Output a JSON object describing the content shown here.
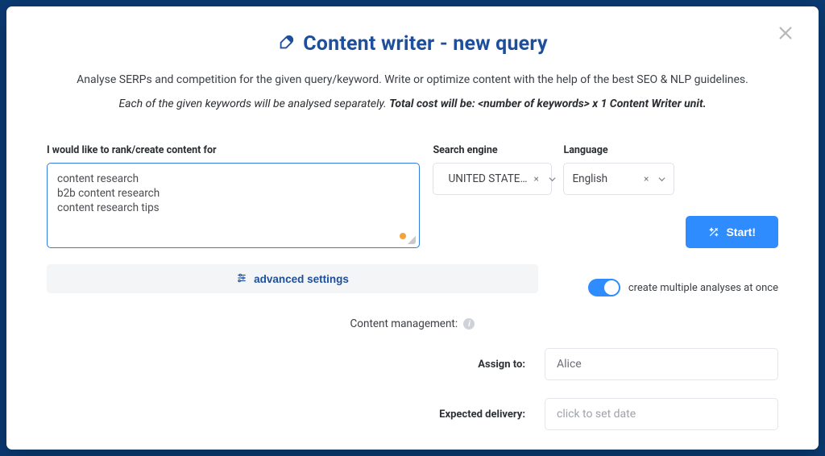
{
  "modal": {
    "title": "Content writer - new query",
    "description": "Analyse SERPs and competition for the given query/keyword. Write or optimize content with the help of the best SEO & NLP guidelines.",
    "cost_prefix": "Each of the given keywords will be analysed separately. ",
    "cost_bold": "Total cost will be: <number of keywords> x 1 Content Writer unit."
  },
  "keywords": {
    "label": "I would like to rank/create content for",
    "value": "content research\nb2b content research\ncontent research tips"
  },
  "search_engine": {
    "label": "Search engine",
    "value": "UNITED STATE…",
    "clear": "×"
  },
  "language": {
    "label": "Language",
    "value": "English",
    "clear": "×"
  },
  "start_label": "Start!",
  "advanced_label": "advanced settings",
  "toggle_label": "create multiple analyses at once",
  "content_mgmt_label": "Content management:",
  "assign": {
    "label": "Assign to:",
    "value": "Alice"
  },
  "delivery": {
    "label": "Expected delivery:",
    "placeholder": "click to set date"
  }
}
